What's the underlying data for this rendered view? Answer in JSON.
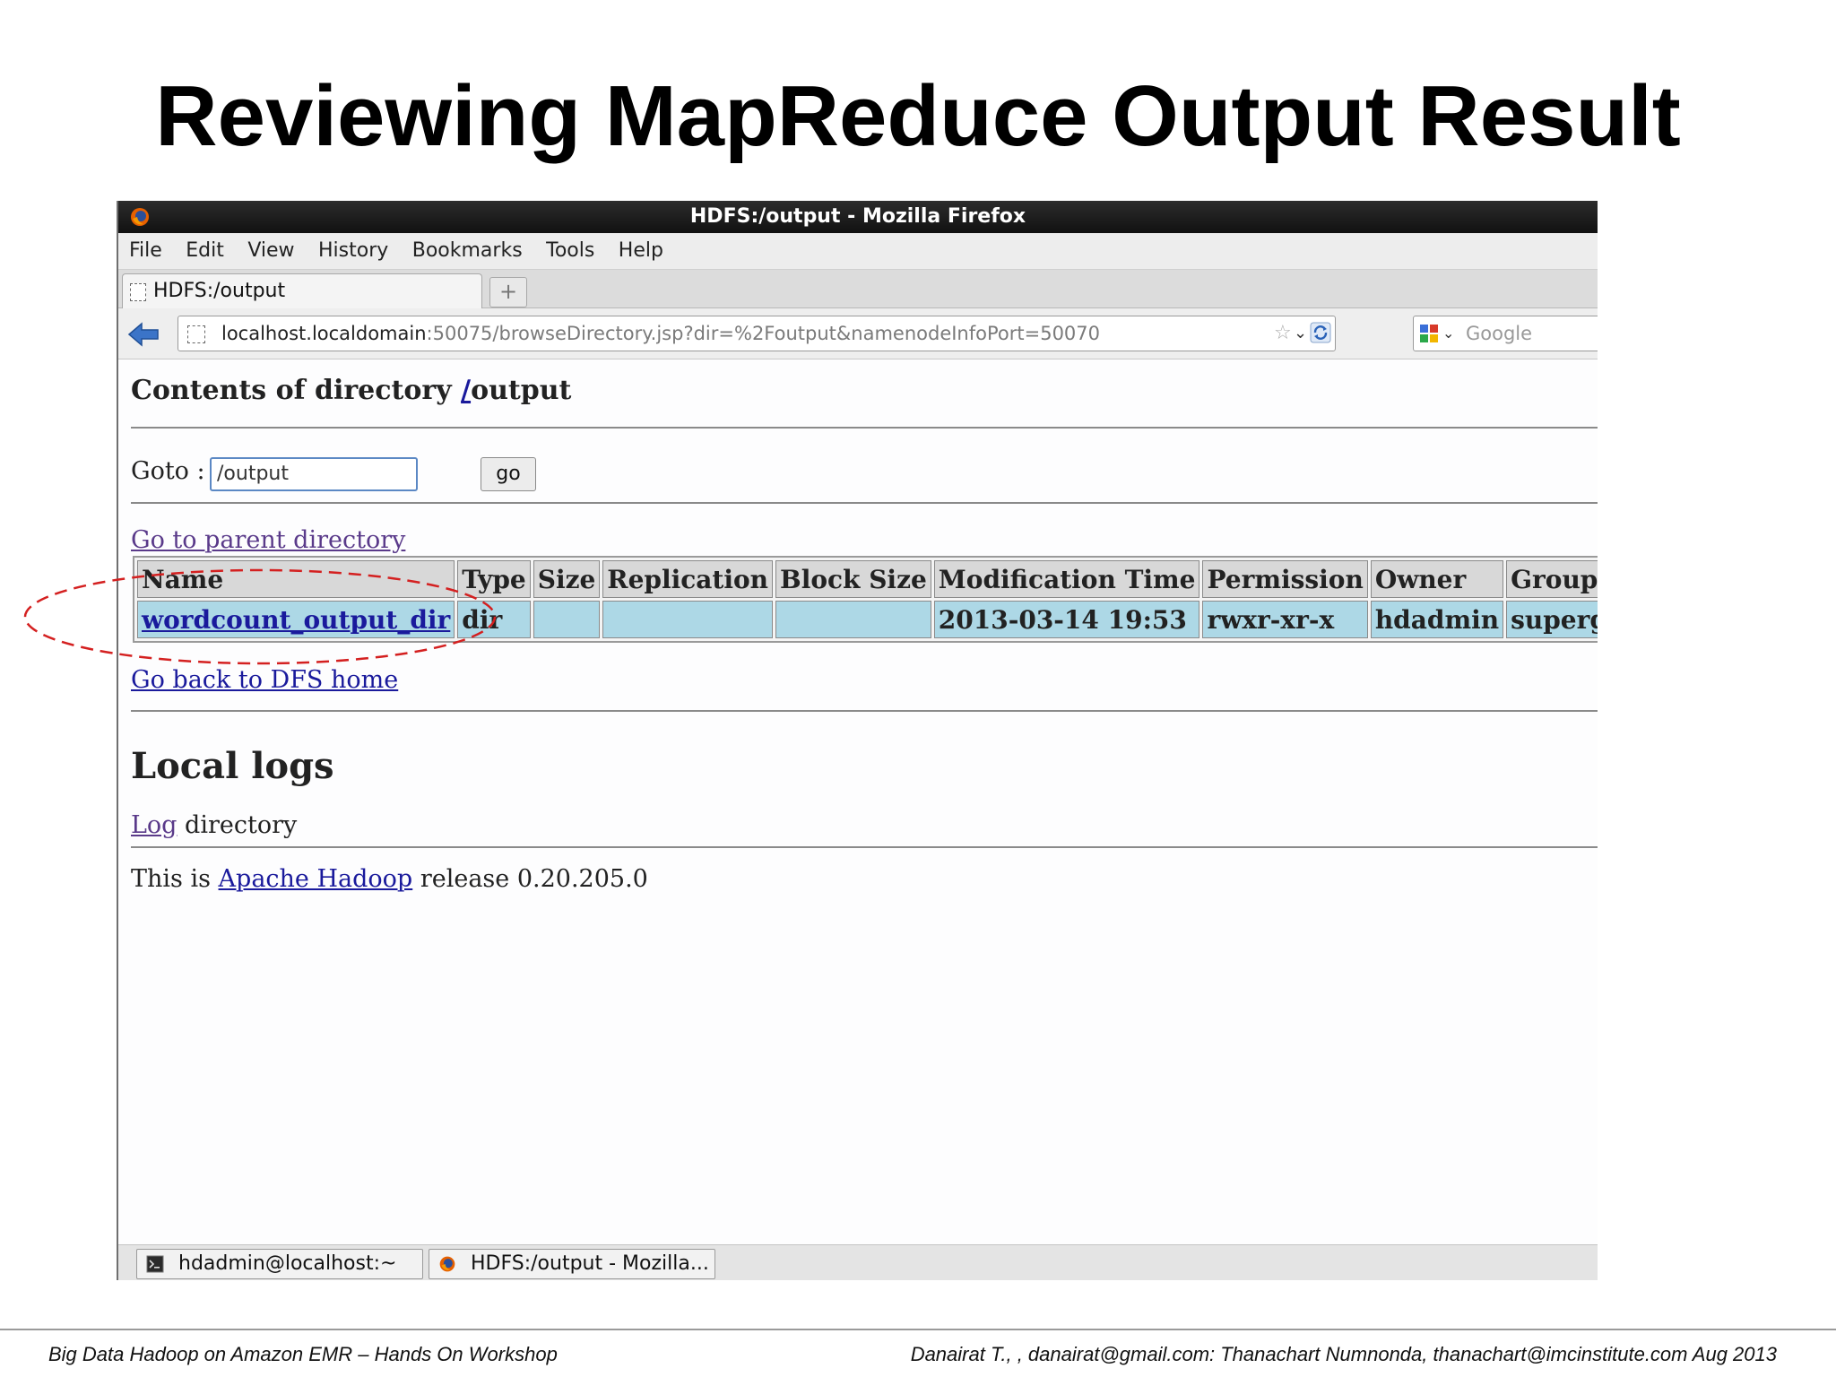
{
  "slide": {
    "title": "Reviewing MapReduce Output Result",
    "footer_left": "Big Data Hadoop on Amazon EMR – Hands On Workshop",
    "footer_right": "Danairat T., , danairat@gmail.com:  Thanachart Numnonda,  thanachart@imcinstitute.com   Aug 2013"
  },
  "window": {
    "title": "HDFS:/output - Mozilla Firefox",
    "menu": [
      "File",
      "Edit",
      "View",
      "History",
      "Bookmarks",
      "Tools",
      "Help"
    ],
    "tab_label": "HDFS:/output",
    "new_tab_label": "+",
    "url_host": "localhost.localdomain",
    "url_rest": ":50075/browseDirectory.jsp?dir=%2Foutput&namenodeInfoPort=50070",
    "search_placeholder": "Google",
    "icons": {
      "back": "back-arrow-icon",
      "bookmark": "star-icon",
      "reload": "reload-icon",
      "search_engine": "google-icon"
    }
  },
  "page": {
    "heading_prefix": "Contents of directory ",
    "heading_link": "/",
    "heading_suffix": "output",
    "goto_label": "Goto : ",
    "goto_value": "/output",
    "go_button": "go",
    "parent_link": "Go to parent directory",
    "table": {
      "headers": [
        "Name",
        "Type",
        "Size",
        "Replication",
        "Block Size",
        "Modification Time",
        "Permission",
        "Owner",
        "Group"
      ],
      "rows": [
        [
          "wordcount_output_dir",
          "dir",
          "",
          "",
          "",
          "2013-03-14 19:53",
          "rwxr-xr-x",
          "hdadmin",
          "supergroup"
        ]
      ]
    },
    "dfs_home_link": "Go back to DFS home",
    "local_logs_heading": "Local logs",
    "log_link": "Log",
    "log_suffix": " directory",
    "release_prefix": "This is ",
    "release_link": "Apache Hadoop",
    "release_suffix": " release 0.20.205.0"
  },
  "taskbar": {
    "items": [
      "hdadmin@localhost:~",
      "HDFS:/output - Mozilla..."
    ]
  },
  "colors": {
    "table_cell": "#add8e6",
    "table_header": "#d8d8d8",
    "annotation_ellipse": "#d42020",
    "link": "#1a1a9c"
  }
}
